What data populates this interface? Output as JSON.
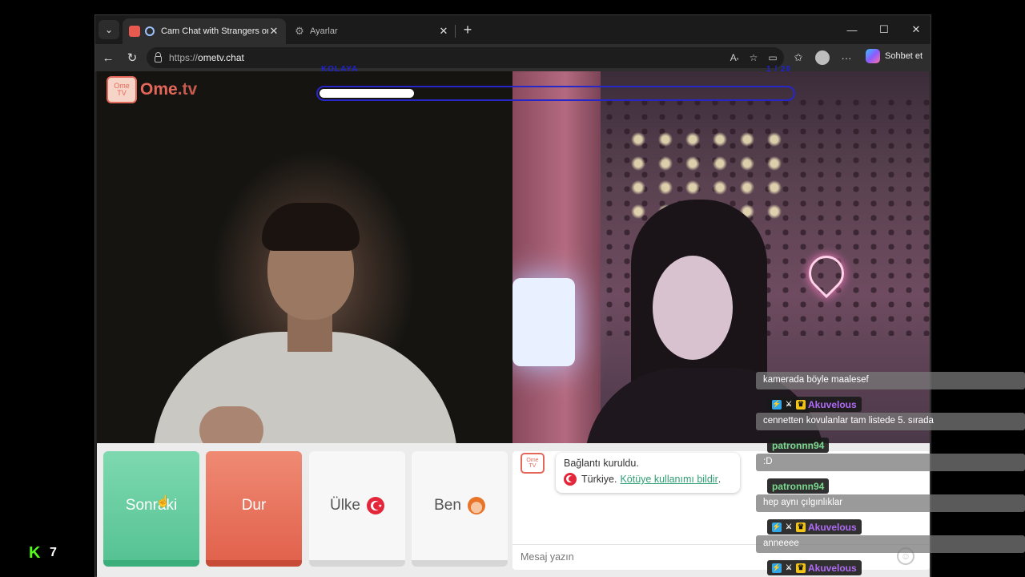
{
  "browser": {
    "tabs": [
      {
        "title": "Cam Chat with Strangers on O",
        "icon": "ometv-favicon"
      },
      {
        "title": "Ayarlar",
        "icon": "gear-icon"
      }
    ],
    "url_protocol": "https://",
    "url_host": "ometv.chat",
    "copilot_label": "Sohbet et"
  },
  "site": {
    "logo_icon_top": "Ome",
    "logo_icon_bottom": "TV",
    "logo_text_main": "Ome",
    "logo_text_tv": ".tv",
    "progress_label_left": "KOLAYA",
    "progress_label_right": "1 / 20",
    "progress_fraction": 0.2
  },
  "controls": {
    "next_label": "Sonraki",
    "stop_label": "Dur",
    "country_label": "Ülke",
    "me_label": "Ben"
  },
  "chat": {
    "system_icon_top": "Ome",
    "system_icon_bottom": "TV",
    "connected_text": "Bağlantı kuruldu.",
    "country_text": "Türkiye.",
    "report_link": "Kötüye kullanımı bildir",
    "report_suffix": ".",
    "input_placeholder": "Mesaj yazın"
  },
  "stream_overlay": {
    "messages": [
      {
        "user": null,
        "text": "kamerada böyle maalesef"
      },
      {
        "user": "Akuvelous",
        "user_color": "#b06af5",
        "badges": true,
        "text": "cennetten kovulanlar tam listede 5. sırada"
      },
      {
        "user": "patronnn94",
        "user_color": "#7ad98f",
        "badges": false,
        "text": ":D"
      },
      {
        "user": "patronnn94",
        "user_color": "#7ad98f",
        "badges": false,
        "text": "hep aynı çılgınlıklar"
      },
      {
        "user": "Akuvelous",
        "user_color": "#b06af5",
        "badges": true,
        "text": "anneeee"
      },
      {
        "user": "Akuvelous",
        "user_color": "#b06af5",
        "badges": true,
        "text": ""
      }
    ]
  },
  "kick": {
    "count": "7"
  }
}
